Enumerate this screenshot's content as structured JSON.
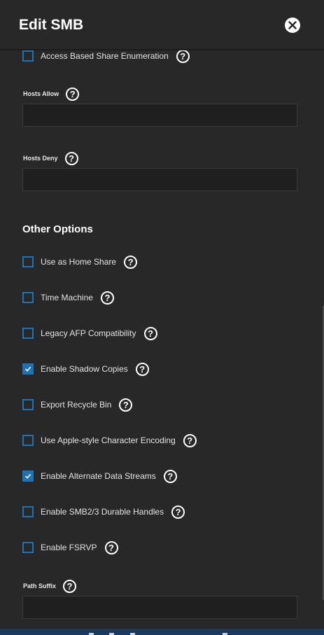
{
  "header": {
    "title": "Edit SMB"
  },
  "icons": {
    "help": "question-circle-icon",
    "close": "close-icon",
    "check": "checkmark-icon"
  },
  "colors": {
    "accent": "#1e73b7",
    "background": "#282828",
    "input_bg": "#1f1f1f"
  },
  "access": {
    "abse": {
      "label": "Access Based Share Enumeration",
      "checked": false
    },
    "hosts_allow": {
      "label": "Hosts Allow",
      "value": ""
    },
    "hosts_deny": {
      "label": "Hosts Deny",
      "value": ""
    }
  },
  "other_options": {
    "title": "Other Options",
    "items": [
      {
        "label": "Use as Home Share",
        "checked": false
      },
      {
        "label": "Time Machine",
        "checked": false
      },
      {
        "label": "Legacy AFP Compatibility",
        "checked": false
      },
      {
        "label": "Enable Shadow Copies",
        "checked": true
      },
      {
        "label": "Export Recycle Bin",
        "checked": false
      },
      {
        "label": "Use Apple-style Character Encoding",
        "checked": false
      },
      {
        "label": "Enable Alternate Data Streams",
        "checked": true
      },
      {
        "label": "Enable SMB2/3 Durable Handles",
        "checked": false
      },
      {
        "label": "Enable FSRVP",
        "checked": false
      }
    ],
    "path_suffix": {
      "label": "Path Suffix",
      "value": ""
    }
  },
  "help_glyph": "?"
}
